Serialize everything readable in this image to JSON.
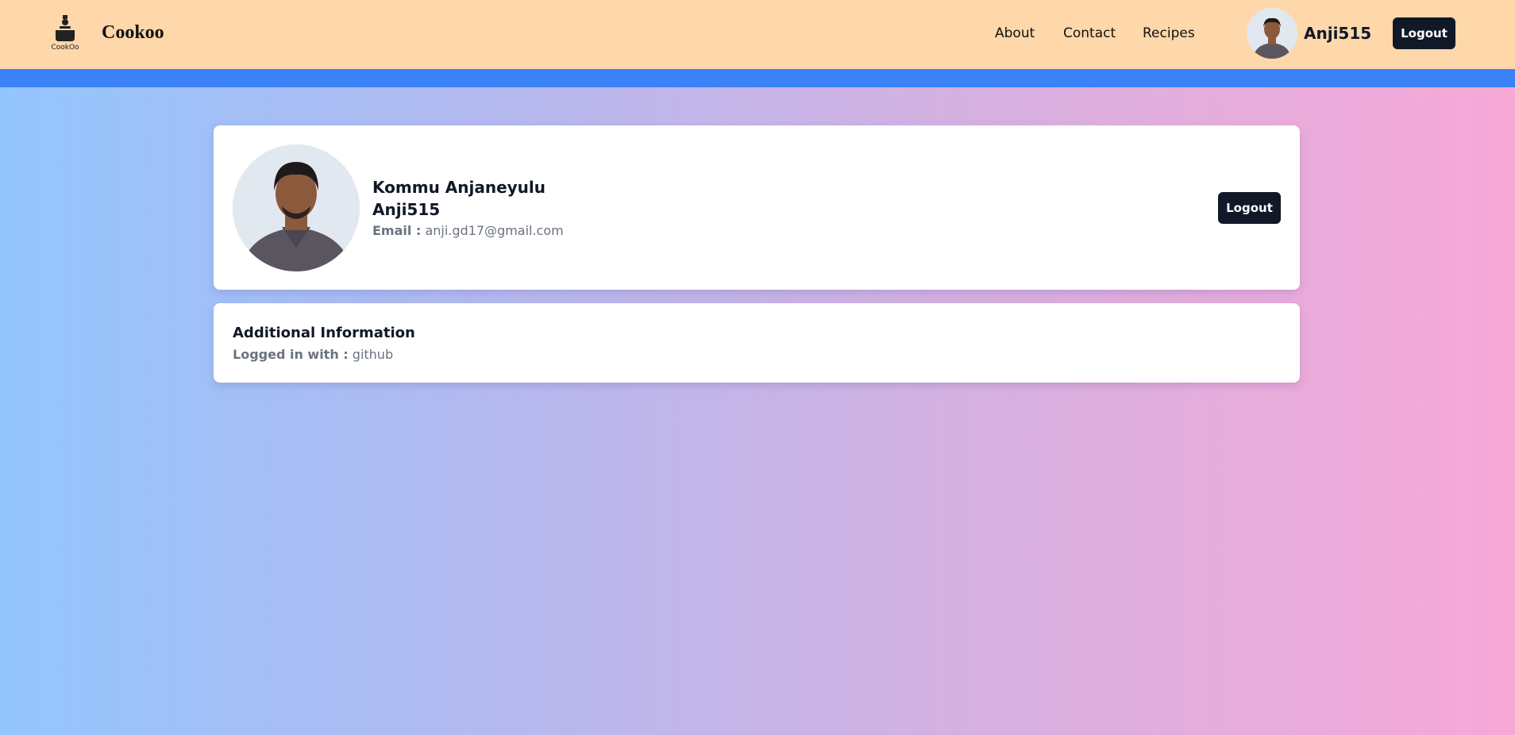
{
  "navbar": {
    "logo_text": "CookOo",
    "brand": "Cookoo",
    "links": [
      "About",
      "Contact",
      "Recipes"
    ],
    "username": "Anji515",
    "logout_label": "Logout"
  },
  "profile": {
    "full_name": "Kommu Anjaneyulu",
    "username": "Anji515",
    "email_label": "Email :",
    "email_value": "anji.gd17@gmail.com",
    "logout_label": "Logout"
  },
  "additional": {
    "title": "Additional Information",
    "login_label": "Logged in with :",
    "login_value": "github"
  },
  "colors": {
    "navbar_bg": "#fed7aa",
    "strip": "#3b82f6",
    "button_bg": "#111827",
    "gradient_start": "#93c5fd",
    "gradient_end": "#f7a8d7"
  }
}
